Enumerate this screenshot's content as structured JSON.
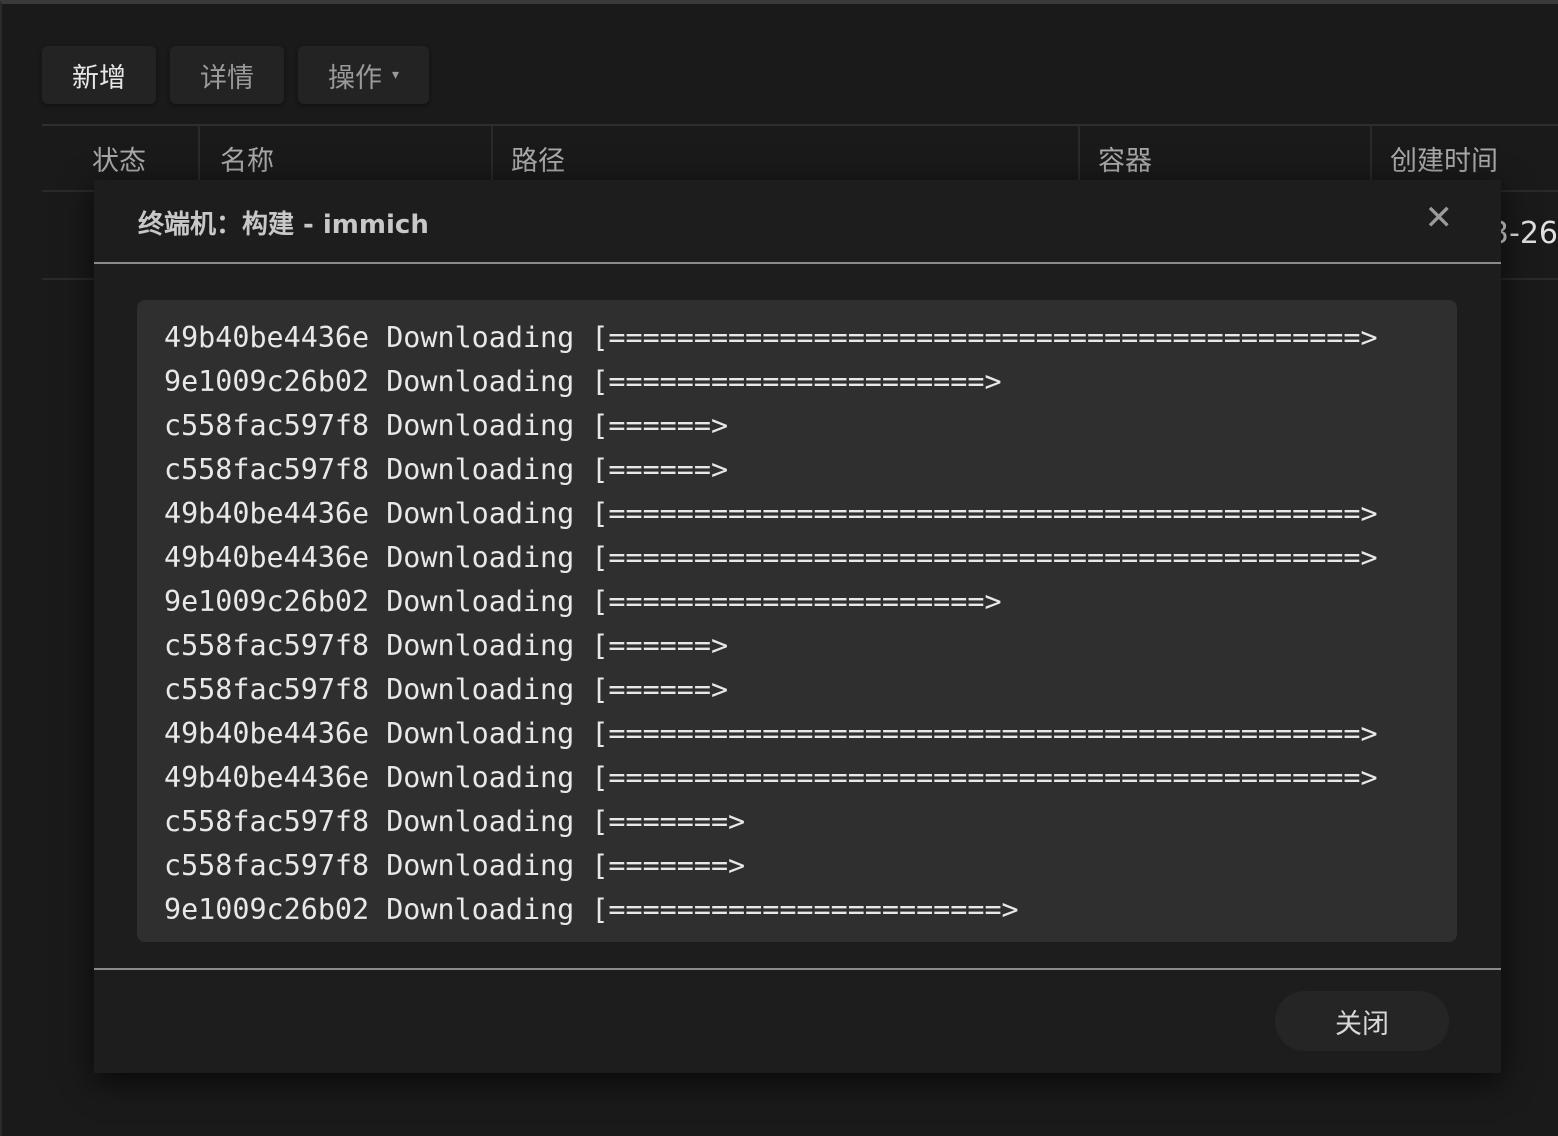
{
  "toolbar": {
    "add": "新增",
    "details": "详情",
    "actions": "操作",
    "actions_caret": "▾"
  },
  "table": {
    "headers": [
      "状态",
      "名称",
      "路径",
      "容器",
      "创建时间"
    ],
    "row_date_fragment": "3-26"
  },
  "modal": {
    "title": "终端机：构建 - immich",
    "close_icon": "✕",
    "lines": [
      "49b40be4436e Downloading [============================================>",
      "9e1009c26b02 Downloading [======================>",
      "c558fac597f8 Downloading [======>",
      "c558fac597f8 Downloading [======>",
      "49b40be4436e Downloading [============================================>",
      "49b40be4436e Downloading [============================================>",
      "9e1009c26b02 Downloading [======================>",
      "c558fac597f8 Downloading [======>",
      "c558fac597f8 Downloading [======>",
      "49b40be4436e Downloading [============================================>",
      "49b40be4436e Downloading [============================================>",
      "c558fac597f8 Downloading [=======>",
      "c558fac597f8 Downloading [=======>",
      "9e1009c26b02 Downloading [=======================>"
    ],
    "close_button": "关闭"
  }
}
